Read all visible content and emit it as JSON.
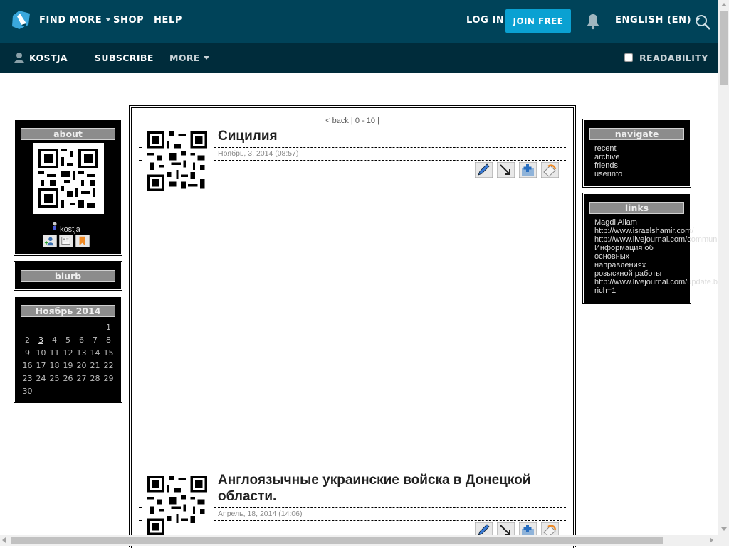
{
  "topbar": {
    "find_more": "FIND MORE",
    "shop": "SHOP",
    "help": "HELP",
    "login": "LOG IN",
    "join": "JOIN FREE",
    "language": "ENGLISH (EN)"
  },
  "subbar": {
    "username": "KOSTJA",
    "subscribe": "SUBSCRIBE",
    "more": "MORE",
    "readability": "READABILITY"
  },
  "about": {
    "title": "about",
    "user": "kostja"
  },
  "blurb": {
    "title": "blurb"
  },
  "calendar": {
    "title": "Ноябрь 2014",
    "weeks": [
      [
        "",
        "",
        "",
        "",
        "",
        "",
        "1"
      ],
      [
        "2",
        "3",
        "4",
        "5",
        "6",
        "7",
        "8"
      ],
      [
        "9",
        "10",
        "11",
        "12",
        "13",
        "14",
        "15"
      ],
      [
        "16",
        "17",
        "18",
        "19",
        "20",
        "21",
        "22"
      ],
      [
        "23",
        "24",
        "25",
        "26",
        "27",
        "28",
        "29"
      ],
      [
        "30",
        "",
        "",
        "",
        "",
        "",
        ""
      ]
    ],
    "linked_day": "3"
  },
  "pager": {
    "back": "< back",
    "range": " | 0 - 10 |"
  },
  "posts": [
    {
      "title": "Сицилия",
      "date": "Ноябрь, 3, 2014 (08:57)"
    },
    {
      "title": "Англоязычные украинские войска в Донецкой области.",
      "date": "Апрель, 18, 2014 (14:06)"
    }
  ],
  "navigate": {
    "title": "navigate",
    "items": [
      "recent",
      "archive",
      "friends",
      "userinfo"
    ]
  },
  "links": {
    "title": "links",
    "items": [
      "Magdi Allam",
      "http://www.israelshamir.com/",
      "http://www.livejournal.com/communit",
      "Информация об",
      "основных",
      "направлениях",
      "розыскной работы",
      "http://www.livejournal.com/update.b",
      "rich=1"
    ]
  },
  "colors": {
    "topbar": "#004359",
    "subbar": "#002c3b",
    "join_button": "#0aa1d2"
  }
}
